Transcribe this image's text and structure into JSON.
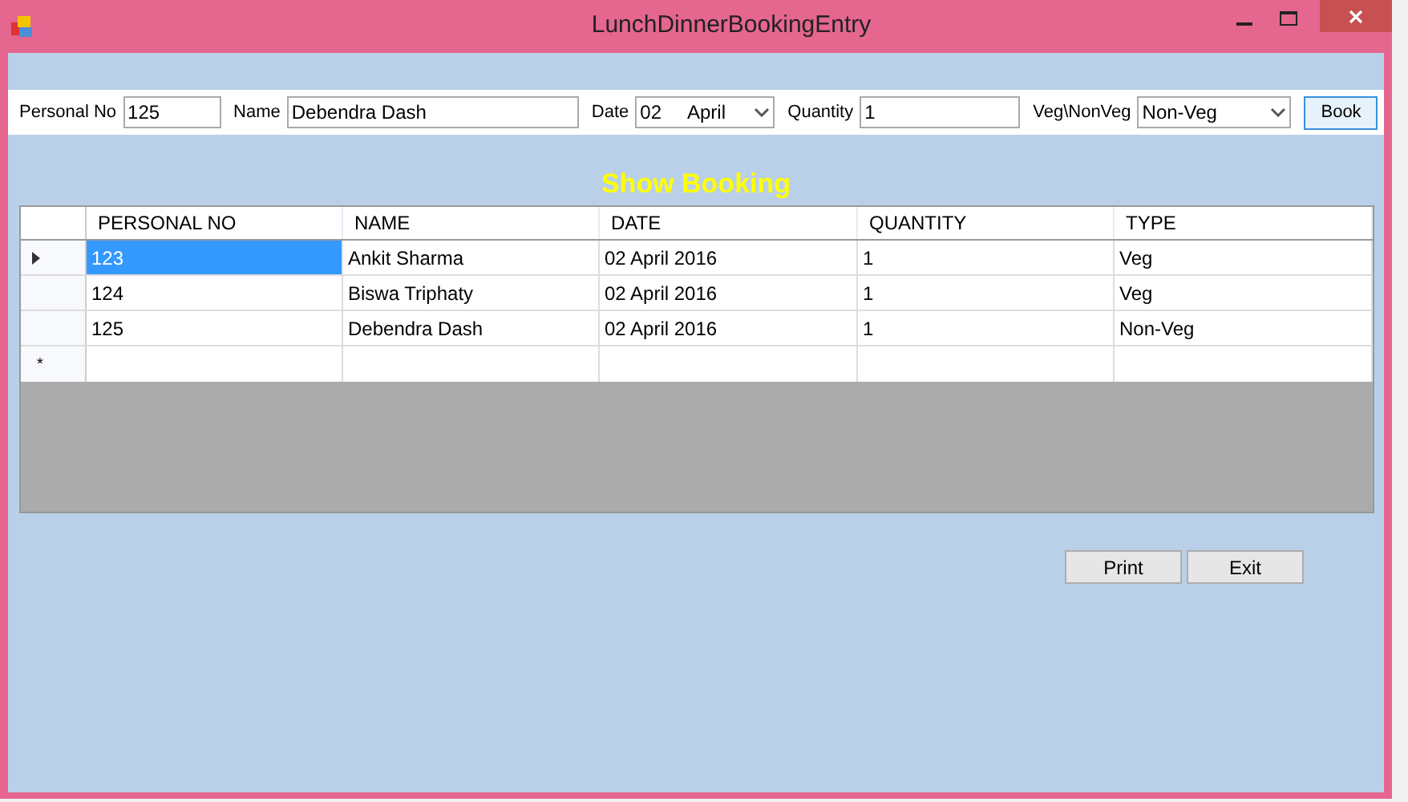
{
  "window": {
    "title": "LunchDinnerBookingEntry"
  },
  "form": [
    {
      "kind": "text",
      "label": "Personal No",
      "value": "125"
    },
    {
      "kind": "text",
      "label": "Name",
      "value": "Debendra Dash"
    },
    {
      "kind": "date",
      "label": "Date",
      "day": "02",
      "month": "April"
    },
    {
      "kind": "text",
      "label": "Quantity",
      "value": "1"
    },
    {
      "kind": "select",
      "label": "Veg\\NonVeg",
      "value": "Non-Veg"
    }
  ],
  "book_button": "Book",
  "heading": "Show Booking",
  "table": {
    "columns": [
      "PERSONAL NO",
      "NAME",
      "DATE",
      "QUANTITY",
      "TYPE"
    ],
    "rows": [
      {
        "selected": true,
        "cells": [
          "123",
          "Ankit Sharma",
          "02 April 2016",
          "1",
          "Veg"
        ]
      },
      {
        "selected": false,
        "cells": [
          "124",
          "Biswa Triphaty",
          "02 April 2016",
          "1",
          "Veg"
        ]
      },
      {
        "selected": false,
        "cells": [
          "125",
          "Debendra Dash",
          "02 April 2016",
          "1",
          "Non-Veg"
        ]
      }
    ],
    "new_row_marker": "*"
  },
  "buttons": [
    "Print",
    "Exit"
  ]
}
